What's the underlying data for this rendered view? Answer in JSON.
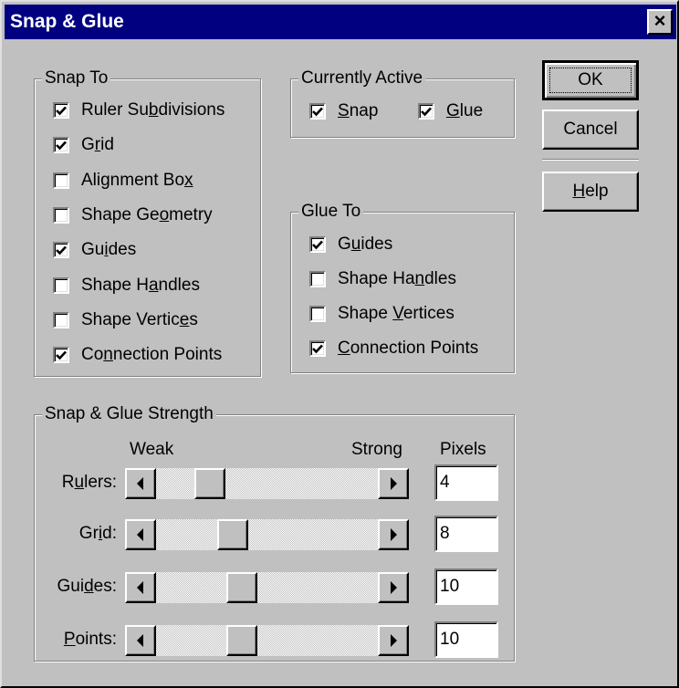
{
  "title": "Snap & Glue",
  "close_label": "×",
  "snap_to": {
    "legend": "Snap To",
    "items": [
      {
        "pre": "Ruler Su",
        "u": "b",
        "post": "divisions",
        "checked": true
      },
      {
        "pre": "G",
        "u": "r",
        "post": "id",
        "checked": true
      },
      {
        "pre": "Alignment Bo",
        "u": "x",
        "post": "",
        "checked": false
      },
      {
        "pre": "Shape Ge",
        "u": "o",
        "post": "metry",
        "checked": false
      },
      {
        "pre": "Gu",
        "u": "i",
        "post": "des",
        "checked": true
      },
      {
        "pre": "Shape H",
        "u": "a",
        "post": "ndles",
        "checked": false
      },
      {
        "pre": "Shape Vertic",
        "u": "e",
        "post": "s",
        "checked": false
      },
      {
        "pre": "Co",
        "u": "n",
        "post": "nection Points",
        "checked": true
      }
    ]
  },
  "currently_active": {
    "legend": "Currently Active",
    "items": [
      {
        "pre": "",
        "u": "S",
        "post": "nap",
        "checked": true
      },
      {
        "pre": "",
        "u": "G",
        "post": "lue",
        "checked": true
      }
    ]
  },
  "glue_to": {
    "legend": "Glue To",
    "items": [
      {
        "pre": "G",
        "u": "u",
        "post": "ides",
        "checked": true
      },
      {
        "pre": "Shape Ha",
        "u": "n",
        "post": "dles",
        "checked": false
      },
      {
        "pre": "Shape ",
        "u": "V",
        "post": "ertices",
        "checked": false
      },
      {
        "pre": "",
        "u": "C",
        "post": "onnection Points",
        "checked": true
      }
    ]
  },
  "buttons": {
    "ok": "OK",
    "cancel": "Cancel",
    "help_pre": "",
    "help_u": "H",
    "help_post": "elp"
  },
  "strength": {
    "legend": "Snap & Glue Strength",
    "weak": "Weak",
    "strong": "Strong",
    "pixels": "Pixels",
    "rows": [
      {
        "pre": "R",
        "u": "u",
        "post": "lers:",
        "level": 0.2,
        "value": "4"
      },
      {
        "pre": "Gr",
        "u": "i",
        "post": "d:",
        "level": 0.32,
        "value": "8"
      },
      {
        "pre": "Gui",
        "u": "d",
        "post": "es:",
        "level": 0.37,
        "value": "10"
      },
      {
        "pre": "",
        "u": "P",
        "post": "oints:",
        "level": 0.37,
        "value": "10"
      }
    ]
  }
}
